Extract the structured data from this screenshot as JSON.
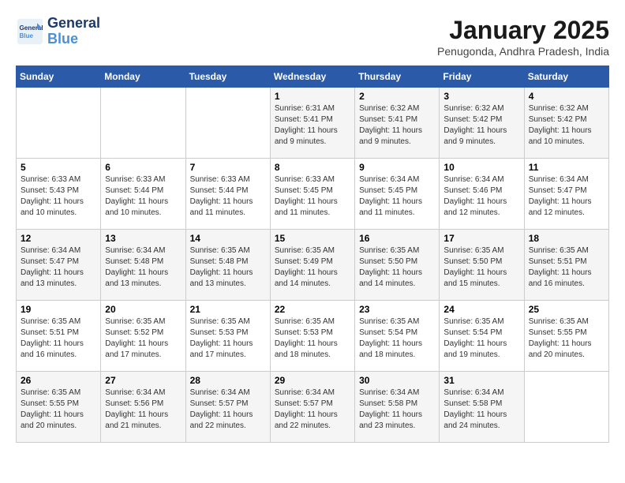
{
  "logo": {
    "line1": "General",
    "line2": "Blue"
  },
  "title": "January 2025",
  "subtitle": "Penugonda, Andhra Pradesh, India",
  "days_header": [
    "Sunday",
    "Monday",
    "Tuesday",
    "Wednesday",
    "Thursday",
    "Friday",
    "Saturday"
  ],
  "weeks": [
    [
      {
        "day": "",
        "info": ""
      },
      {
        "day": "",
        "info": ""
      },
      {
        "day": "",
        "info": ""
      },
      {
        "day": "1",
        "info": "Sunrise: 6:31 AM\nSunset: 5:41 PM\nDaylight: 11 hours and 9 minutes."
      },
      {
        "day": "2",
        "info": "Sunrise: 6:32 AM\nSunset: 5:41 PM\nDaylight: 11 hours and 9 minutes."
      },
      {
        "day": "3",
        "info": "Sunrise: 6:32 AM\nSunset: 5:42 PM\nDaylight: 11 hours and 9 minutes."
      },
      {
        "day": "4",
        "info": "Sunrise: 6:32 AM\nSunset: 5:42 PM\nDaylight: 11 hours and 10 minutes."
      }
    ],
    [
      {
        "day": "5",
        "info": "Sunrise: 6:33 AM\nSunset: 5:43 PM\nDaylight: 11 hours and 10 minutes."
      },
      {
        "day": "6",
        "info": "Sunrise: 6:33 AM\nSunset: 5:44 PM\nDaylight: 11 hours and 10 minutes."
      },
      {
        "day": "7",
        "info": "Sunrise: 6:33 AM\nSunset: 5:44 PM\nDaylight: 11 hours and 11 minutes."
      },
      {
        "day": "8",
        "info": "Sunrise: 6:33 AM\nSunset: 5:45 PM\nDaylight: 11 hours and 11 minutes."
      },
      {
        "day": "9",
        "info": "Sunrise: 6:34 AM\nSunset: 5:45 PM\nDaylight: 11 hours and 11 minutes."
      },
      {
        "day": "10",
        "info": "Sunrise: 6:34 AM\nSunset: 5:46 PM\nDaylight: 11 hours and 12 minutes."
      },
      {
        "day": "11",
        "info": "Sunrise: 6:34 AM\nSunset: 5:47 PM\nDaylight: 11 hours and 12 minutes."
      }
    ],
    [
      {
        "day": "12",
        "info": "Sunrise: 6:34 AM\nSunset: 5:47 PM\nDaylight: 11 hours and 13 minutes."
      },
      {
        "day": "13",
        "info": "Sunrise: 6:34 AM\nSunset: 5:48 PM\nDaylight: 11 hours and 13 minutes."
      },
      {
        "day": "14",
        "info": "Sunrise: 6:35 AM\nSunset: 5:48 PM\nDaylight: 11 hours and 13 minutes."
      },
      {
        "day": "15",
        "info": "Sunrise: 6:35 AM\nSunset: 5:49 PM\nDaylight: 11 hours and 14 minutes."
      },
      {
        "day": "16",
        "info": "Sunrise: 6:35 AM\nSunset: 5:50 PM\nDaylight: 11 hours and 14 minutes."
      },
      {
        "day": "17",
        "info": "Sunrise: 6:35 AM\nSunset: 5:50 PM\nDaylight: 11 hours and 15 minutes."
      },
      {
        "day": "18",
        "info": "Sunrise: 6:35 AM\nSunset: 5:51 PM\nDaylight: 11 hours and 16 minutes."
      }
    ],
    [
      {
        "day": "19",
        "info": "Sunrise: 6:35 AM\nSunset: 5:51 PM\nDaylight: 11 hours and 16 minutes."
      },
      {
        "day": "20",
        "info": "Sunrise: 6:35 AM\nSunset: 5:52 PM\nDaylight: 11 hours and 17 minutes."
      },
      {
        "day": "21",
        "info": "Sunrise: 6:35 AM\nSunset: 5:53 PM\nDaylight: 11 hours and 17 minutes."
      },
      {
        "day": "22",
        "info": "Sunrise: 6:35 AM\nSunset: 5:53 PM\nDaylight: 11 hours and 18 minutes."
      },
      {
        "day": "23",
        "info": "Sunrise: 6:35 AM\nSunset: 5:54 PM\nDaylight: 11 hours and 18 minutes."
      },
      {
        "day": "24",
        "info": "Sunrise: 6:35 AM\nSunset: 5:54 PM\nDaylight: 11 hours and 19 minutes."
      },
      {
        "day": "25",
        "info": "Sunrise: 6:35 AM\nSunset: 5:55 PM\nDaylight: 11 hours and 20 minutes."
      }
    ],
    [
      {
        "day": "26",
        "info": "Sunrise: 6:35 AM\nSunset: 5:55 PM\nDaylight: 11 hours and 20 minutes."
      },
      {
        "day": "27",
        "info": "Sunrise: 6:34 AM\nSunset: 5:56 PM\nDaylight: 11 hours and 21 minutes."
      },
      {
        "day": "28",
        "info": "Sunrise: 6:34 AM\nSunset: 5:57 PM\nDaylight: 11 hours and 22 minutes."
      },
      {
        "day": "29",
        "info": "Sunrise: 6:34 AM\nSunset: 5:57 PM\nDaylight: 11 hours and 22 minutes."
      },
      {
        "day": "30",
        "info": "Sunrise: 6:34 AM\nSunset: 5:58 PM\nDaylight: 11 hours and 23 minutes."
      },
      {
        "day": "31",
        "info": "Sunrise: 6:34 AM\nSunset: 5:58 PM\nDaylight: 11 hours and 24 minutes."
      },
      {
        "day": "",
        "info": ""
      }
    ]
  ]
}
